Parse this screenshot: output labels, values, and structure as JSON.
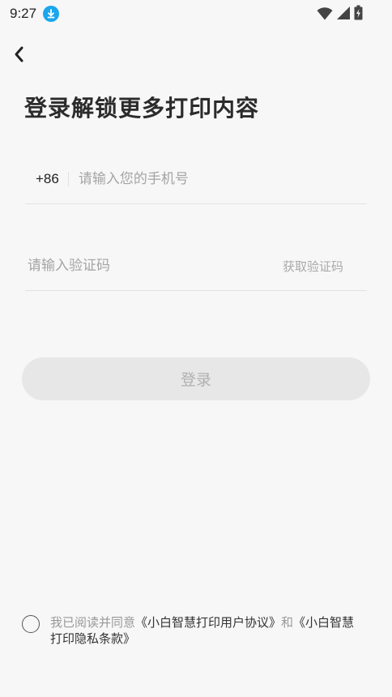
{
  "status_bar": {
    "time": "9:27",
    "icons": [
      "download-icon",
      "wifi-icon",
      "signal-icon",
      "battery-charging-icon"
    ]
  },
  "page": {
    "title": "登录解锁更多打印内容"
  },
  "phone": {
    "country_code": "+86",
    "placeholder": "请输入您的手机号",
    "value": ""
  },
  "verification": {
    "placeholder": "请输入验证码",
    "value": "",
    "get_code_label": "获取验证码"
  },
  "login_button": {
    "label": "登录"
  },
  "agreement": {
    "prefix": "我已阅读并同意",
    "user_agreement": "《小白智慧打印用户协议》",
    "conjunction": "和",
    "privacy_policy": "《小白智慧打印隐私条款》",
    "checked": false
  },
  "colors": {
    "download_badge": "#1aa7ec",
    "background": "#f7f7f7",
    "button_disabled_bg": "#e7e7e7",
    "button_disabled_text": "#b0b0b0"
  }
}
